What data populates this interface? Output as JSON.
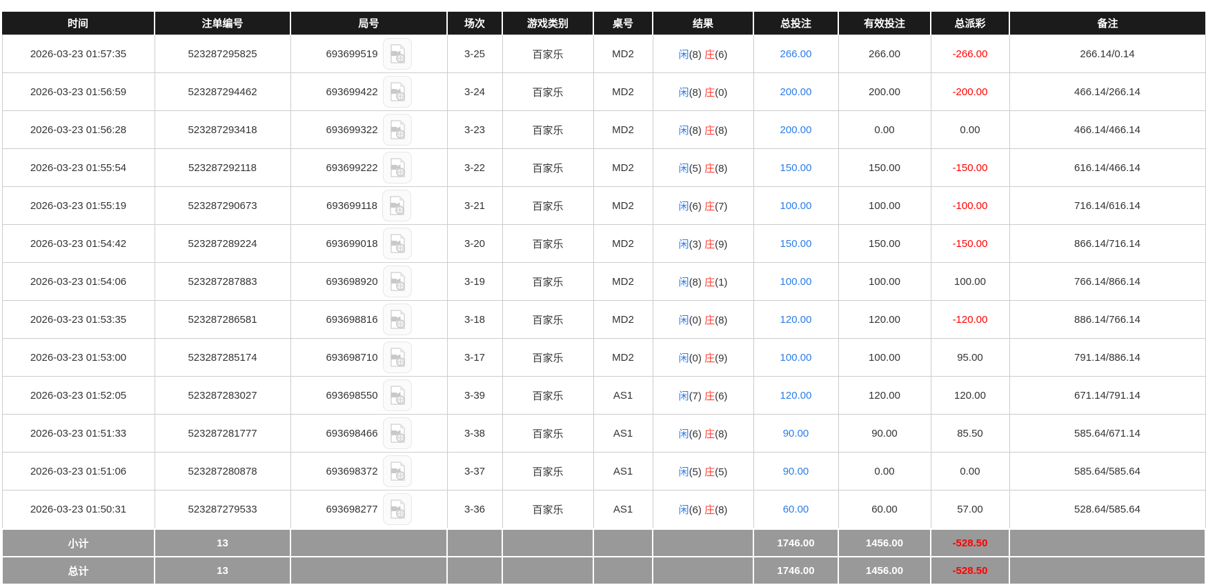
{
  "table": {
    "columns": [
      {
        "key": "time",
        "label": "时间"
      },
      {
        "key": "bet_no",
        "label": "注单编号"
      },
      {
        "key": "round_no",
        "label": "局号"
      },
      {
        "key": "session",
        "label": "场次"
      },
      {
        "key": "game",
        "label": "游戏类别"
      },
      {
        "key": "table_no",
        "label": "桌号"
      },
      {
        "key": "result",
        "label": "结果"
      },
      {
        "key": "total_bet",
        "label": "总投注"
      },
      {
        "key": "valid_bet",
        "label": "有效投注"
      },
      {
        "key": "payout",
        "label": "总派彩"
      },
      {
        "key": "remark",
        "label": "备注"
      }
    ],
    "colors": {
      "header_bg": "#1b1b1b",
      "footer_bg": "#999999",
      "accent_blue": "#2b7ce9",
      "negative_red": "#ff0000",
      "banker_red": "#ff3b30"
    },
    "icons": {
      "round_video_icon": "video-replay-icon"
    },
    "rows": [
      {
        "time": "2026-03-23 01:57:35",
        "bet_no": "523287295825",
        "round_no": "693699519",
        "session": "3-25",
        "game": "百家乐",
        "table_no": "MD2",
        "result": {
          "player_label": "闲",
          "player_score": "(8)",
          "banker_label": "庄",
          "banker_score": "(6)"
        },
        "total_bet": "266.00",
        "valid_bet": "266.00",
        "payout": "-266.00",
        "remark": "266.14/0.14"
      },
      {
        "time": "2026-03-23 01:56:59",
        "bet_no": "523287294462",
        "round_no": "693699422",
        "session": "3-24",
        "game": "百家乐",
        "table_no": "MD2",
        "result": {
          "player_label": "闲",
          "player_score": "(8)",
          "banker_label": "庄",
          "banker_score": "(0)"
        },
        "total_bet": "200.00",
        "valid_bet": "200.00",
        "payout": "-200.00",
        "remark": "466.14/266.14"
      },
      {
        "time": "2026-03-23 01:56:28",
        "bet_no": "523287293418",
        "round_no": "693699322",
        "session": "3-23",
        "game": "百家乐",
        "table_no": "MD2",
        "result": {
          "player_label": "闲",
          "player_score": "(8)",
          "banker_label": "庄",
          "banker_score": "(8)"
        },
        "total_bet": "200.00",
        "valid_bet": "0.00",
        "payout": "0.00",
        "remark": "466.14/466.14"
      },
      {
        "time": "2026-03-23 01:55:54",
        "bet_no": "523287292118",
        "round_no": "693699222",
        "session": "3-22",
        "game": "百家乐",
        "table_no": "MD2",
        "result": {
          "player_label": "闲",
          "player_score": "(5)",
          "banker_label": "庄",
          "banker_score": "(8)"
        },
        "total_bet": "150.00",
        "valid_bet": "150.00",
        "payout": "-150.00",
        "remark": "616.14/466.14"
      },
      {
        "time": "2026-03-23 01:55:19",
        "bet_no": "523287290673",
        "round_no": "693699118",
        "session": "3-21",
        "game": "百家乐",
        "table_no": "MD2",
        "result": {
          "player_label": "闲",
          "player_score": "(6)",
          "banker_label": "庄",
          "banker_score": "(7)"
        },
        "total_bet": "100.00",
        "valid_bet": "100.00",
        "payout": "-100.00",
        "remark": "716.14/616.14"
      },
      {
        "time": "2026-03-23 01:54:42",
        "bet_no": "523287289224",
        "round_no": "693699018",
        "session": "3-20",
        "game": "百家乐",
        "table_no": "MD2",
        "result": {
          "player_label": "闲",
          "player_score": "(3)",
          "banker_label": "庄",
          "banker_score": "(9)"
        },
        "total_bet": "150.00",
        "valid_bet": "150.00",
        "payout": "-150.00",
        "remark": "866.14/716.14"
      },
      {
        "time": "2026-03-23 01:54:06",
        "bet_no": "523287287883",
        "round_no": "693698920",
        "session": "3-19",
        "game": "百家乐",
        "table_no": "MD2",
        "result": {
          "player_label": "闲",
          "player_score": "(8)",
          "banker_label": "庄",
          "banker_score": "(1)"
        },
        "total_bet": "100.00",
        "valid_bet": "100.00",
        "payout": "100.00",
        "remark": "766.14/866.14"
      },
      {
        "time": "2026-03-23 01:53:35",
        "bet_no": "523287286581",
        "round_no": "693698816",
        "session": "3-18",
        "game": "百家乐",
        "table_no": "MD2",
        "result": {
          "player_label": "闲",
          "player_score": "(0)",
          "banker_label": "庄",
          "banker_score": "(8)"
        },
        "total_bet": "120.00",
        "valid_bet": "120.00",
        "payout": "-120.00",
        "remark": "886.14/766.14"
      },
      {
        "time": "2026-03-23 01:53:00",
        "bet_no": "523287285174",
        "round_no": "693698710",
        "session": "3-17",
        "game": "百家乐",
        "table_no": "MD2",
        "result": {
          "player_label": "闲",
          "player_score": "(0)",
          "banker_label": "庄",
          "banker_score": "(9)"
        },
        "total_bet": "100.00",
        "valid_bet": "100.00",
        "payout": "95.00",
        "remark": "791.14/886.14"
      },
      {
        "time": "2026-03-23 01:52:05",
        "bet_no": "523287283027",
        "round_no": "693698550",
        "session": "3-39",
        "game": "百家乐",
        "table_no": "AS1",
        "result": {
          "player_label": "闲",
          "player_score": "(7)",
          "banker_label": "庄",
          "banker_score": "(6)"
        },
        "total_bet": "120.00",
        "valid_bet": "120.00",
        "payout": "120.00",
        "remark": "671.14/791.14"
      },
      {
        "time": "2026-03-23 01:51:33",
        "bet_no": "523287281777",
        "round_no": "693698466",
        "session": "3-38",
        "game": "百家乐",
        "table_no": "AS1",
        "result": {
          "player_label": "闲",
          "player_score": "(6)",
          "banker_label": "庄",
          "banker_score": "(8)"
        },
        "total_bet": "90.00",
        "valid_bet": "90.00",
        "payout": "85.50",
        "remark": "585.64/671.14"
      },
      {
        "time": "2026-03-23 01:51:06",
        "bet_no": "523287280878",
        "round_no": "693698372",
        "session": "3-37",
        "game": "百家乐",
        "table_no": "AS1",
        "result": {
          "player_label": "闲",
          "player_score": "(5)",
          "banker_label": "庄",
          "banker_score": "(5)"
        },
        "total_bet": "90.00",
        "valid_bet": "0.00",
        "payout": "0.00",
        "remark": "585.64/585.64"
      },
      {
        "time": "2026-03-23 01:50:31",
        "bet_no": "523287279533",
        "round_no": "693698277",
        "session": "3-36",
        "game": "百家乐",
        "table_no": "AS1",
        "result": {
          "player_label": "闲",
          "player_score": "(6)",
          "banker_label": "庄",
          "banker_score": "(8)"
        },
        "total_bet": "60.00",
        "valid_bet": "60.00",
        "payout": "57.00",
        "remark": "528.64/585.64"
      }
    ],
    "footer": [
      {
        "label": "小计",
        "count": "13",
        "total_bet": "1746.00",
        "valid_bet": "1456.00",
        "payout": "-528.50"
      },
      {
        "label": "总计",
        "count": "13",
        "total_bet": "1746.00",
        "valid_bet": "1456.00",
        "payout": "-528.50"
      }
    ]
  }
}
